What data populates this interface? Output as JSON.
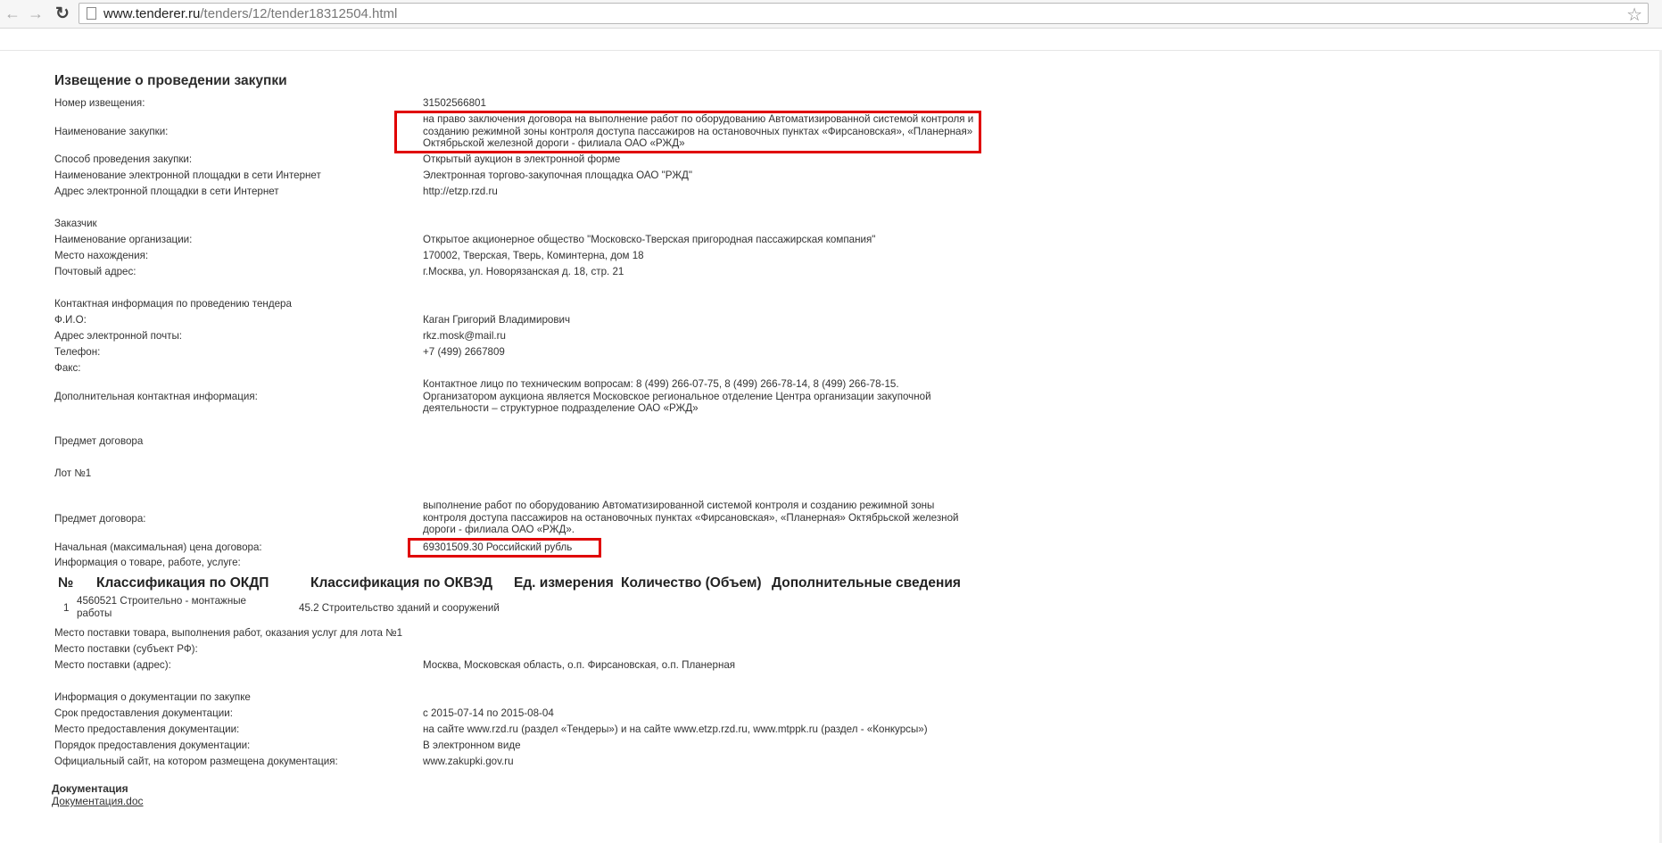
{
  "browser": {
    "url_host": "www.tenderer.ru",
    "url_path": "/tenders/12/tender18312504.html"
  },
  "notice": {
    "heading": "Извещение о проведении закупки",
    "rows": [
      {
        "label": "Номер извещения:",
        "value": "31502566801"
      },
      {
        "label": "Наименование закупки:",
        "value": "на право заключения договора на выполнение работ по оборудованию Автоматизированной системой контроля и созданию режимной зоны контроля доступа пассажиров на остановочных пунктах «Фирсановская», «Планерная» Октябрьской железной дороги - филиала ОАО «РЖД»"
      },
      {
        "label": "Способ проведения закупки:",
        "value": "Открытый аукцион в электронной форме"
      },
      {
        "label": "Наименование электронной площадки в сети Интернет",
        "value": "Электронная торгово-закупочная площадка ОАО \"РЖД\""
      },
      {
        "label": "Адрес электронной площадки в сети Интернет",
        "value": "http://etzp.rzd.ru"
      }
    ]
  },
  "customer": {
    "section": "Заказчик",
    "rows": [
      {
        "label": "Наименование организации:",
        "value": "Открытое акционерное общество \"Московско-Тверская пригородная пассажирская компания\""
      },
      {
        "label": "Место нахождения:",
        "value": "170002, Тверская, Тверь, Коминтерна, дом 18"
      },
      {
        "label": "Почтовый адрес:",
        "value": "г.Москва, ул. Новорязанская д. 18, стр. 21"
      }
    ]
  },
  "contact": {
    "section": "Контактная информация по проведению тендера",
    "rows": [
      {
        "label": "Ф.И.О:",
        "value": "Каган Григорий Владимирович"
      },
      {
        "label": "Адрес электронной почты:",
        "value": "rkz.mosk@mail.ru"
      },
      {
        "label": "Телефон:",
        "value": "+7 (499) 2667809"
      },
      {
        "label": "Факс:",
        "value": ""
      },
      {
        "label": "Дополнительная контактная информация:",
        "value": "Контактное лицо по техническим вопросам: 8 (499) 266-07-75, 8 (499) 266-78-14, 8 (499) 266-78-15. Организатором аукциона является Московское региональное отделение Центра организации закупочной деятельности – структурное подразделение ОАО «РЖД»"
      }
    ]
  },
  "subject": {
    "section": "Предмет договора",
    "lot": "Лот №1",
    "rows": [
      {
        "label": "Предмет договора:",
        "value": "выполнение работ по оборудованию Автоматизированной системой контроля и созданию режимной зоны контроля доступа пассажиров на остановочных пунктах «Фирсановская», «Планерная» Октябрьской железной дороги - филиала ОАО «РЖД»."
      },
      {
        "label": "Начальная (максимальная) цена договора:",
        "value": "69301509.30 Российский рубль"
      }
    ],
    "goods_info_label": "Информация о товаре, работе, услуге:"
  },
  "table": {
    "headers": [
      "№",
      "Классификация по ОКДП",
      "Классификация по ОКВЭД",
      "Ед. измерения",
      "Количество (Объем)",
      "Дополнительные сведения"
    ],
    "rows": [
      {
        "num": "1",
        "okdp": "4560521 Строительно - монтажные работы",
        "okved": "45.2 Строительство зданий и сооружений",
        "unit": "",
        "qty": "",
        "extra": ""
      }
    ]
  },
  "delivery": {
    "title": "Место поставки товара, выполнения работ, оказания услуг для лота №1",
    "rows": [
      {
        "label": "Место поставки (субъект РФ):",
        "value": ""
      },
      {
        "label": "Место поставки (адрес):",
        "value": "Москва, Московская область, о.п. Фирсановская, о.п. Планерная"
      }
    ]
  },
  "documentation": {
    "section": "Информация о документации по закупке",
    "rows": [
      {
        "label": "Срок предоставления документации:",
        "value": "с 2015-07-14 по 2015-08-04"
      },
      {
        "label": "Место предоставления документации:",
        "value": "на сайте www.rzd.ru (раздел «Тендеры») и на сайте www.etzp.rzd.ru, www.mtppk.ru (раздел - «Конкурсы»)"
      },
      {
        "label": "Порядок предоставления документации:",
        "value": "В электронном виде"
      },
      {
        "label": "Официальный сайт, на котором размещена документация:",
        "value": "www.zakupki.gov.ru"
      }
    ],
    "docs_title": "Документация",
    "doc_link": "Документация.doc"
  }
}
